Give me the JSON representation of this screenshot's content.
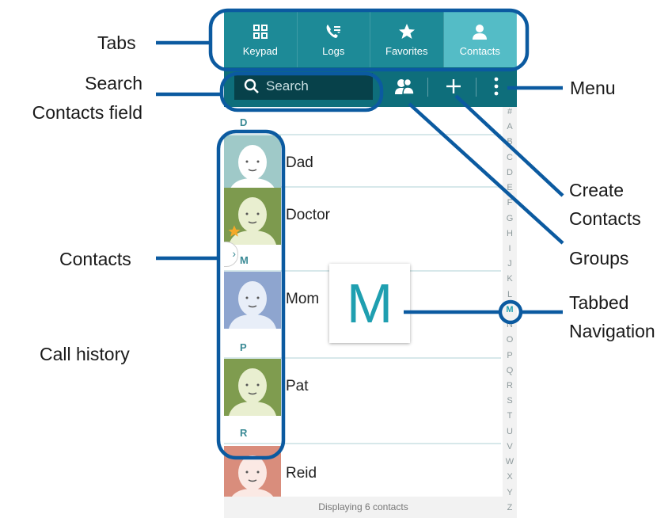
{
  "callouts": {
    "tabs": "Tabs",
    "search_line1": "Search",
    "search_line2": "Contacts field",
    "menu": "Menu",
    "create_line1": "Create",
    "create_line2": "Contacts",
    "groups": "Groups",
    "contacts": "Contacts",
    "tabbed_line1": "Tabbed",
    "tabbed_line2": "Navigation",
    "call_history": "Call history"
  },
  "tabs": [
    {
      "label": "Keypad",
      "icon": "keypad-icon",
      "active": false
    },
    {
      "label": "Logs",
      "icon": "logs-icon",
      "active": false
    },
    {
      "label": "Favorites",
      "icon": "star-icon",
      "active": false
    },
    {
      "label": "Contacts",
      "icon": "person-icon",
      "active": true
    }
  ],
  "search": {
    "placeholder": "Search",
    "icon": "search-icon"
  },
  "actions": {
    "groups_icon": "groups-icon",
    "create_icon": "plus-icon",
    "menu_icon": "kebab-menu-icon"
  },
  "sections": [
    "D",
    "M",
    "P",
    "R"
  ],
  "contacts": [
    {
      "name": "Dad",
      "section": "D",
      "avatar_color": "#9fc9c8",
      "favorite": false
    },
    {
      "name": "Doctor",
      "section": "D",
      "avatar_color": "#7d9a4e",
      "favorite": true
    },
    {
      "name": "Mom",
      "section": "M",
      "avatar_color": "#8ea5cf",
      "favorite": false
    },
    {
      "name": "Pat",
      "section": "P",
      "avatar_color": "#7f9c4f",
      "favorite": false
    },
    {
      "name": "Reid",
      "section": "R",
      "avatar_color": "#d98d7c",
      "favorite": false
    }
  ],
  "index_letters": [
    "#",
    "A",
    "B",
    "C",
    "D",
    "E",
    "F",
    "G",
    "H",
    "I",
    "J",
    "K",
    "L",
    "M",
    "N",
    "O",
    "P",
    "Q",
    "R",
    "S",
    "T",
    "U",
    "V",
    "W",
    "X",
    "Y",
    "Z"
  ],
  "index_selected": "M",
  "big_letter": "M",
  "footer": "Displaying 6 contacts",
  "colors": {
    "tab_bar": "#1d8a97",
    "tab_active": "#54bcc6",
    "action_bar": "#0e6e7b",
    "callout_line": "#0b5aa0",
    "accent": "#1f9fb0"
  }
}
